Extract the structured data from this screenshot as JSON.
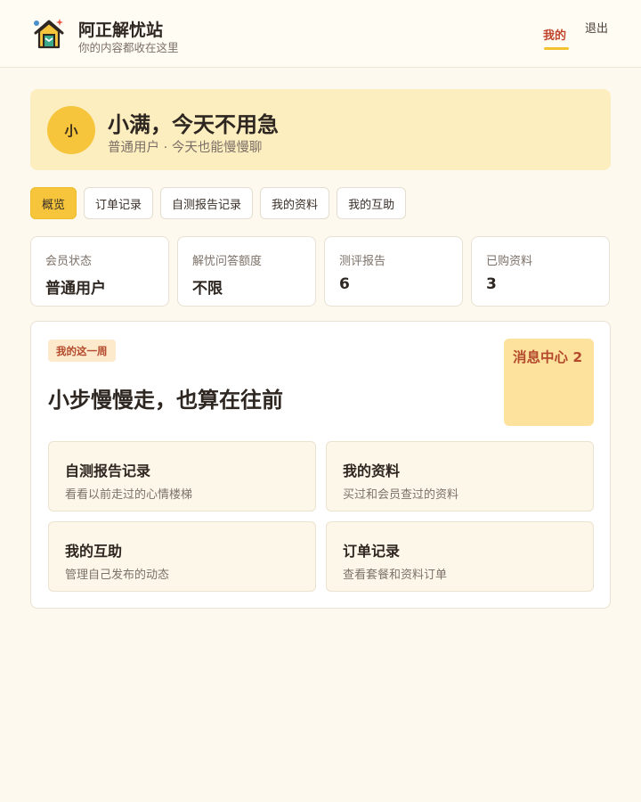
{
  "header": {
    "logo_icon": "house-icon",
    "title": "阿正解忧站",
    "subtitle": "你的内容都收在这里",
    "nav_mine": "我的",
    "nav_logout": "退出"
  },
  "profile": {
    "avatar": "小",
    "greeting": "小满，今天不用急",
    "subtitle": "普通用户 · 今天也能慢慢聊"
  },
  "tabs": [
    {
      "label": "概览",
      "active": true
    },
    {
      "label": "订单记录"
    },
    {
      "label": "自测报告记录"
    },
    {
      "label": "我的资料"
    },
    {
      "label": "我的互助"
    }
  ],
  "stats": [
    {
      "label": "会员状态",
      "value": "普通用户"
    },
    {
      "label": "解忧问答额度",
      "value": "不限"
    },
    {
      "label": "测评报告",
      "value": "6"
    },
    {
      "label": "已购资料",
      "value": "3"
    }
  ],
  "week": {
    "badge": "我的这一周",
    "title": "小步慢慢走，也算在往前",
    "message_center": "消息中心 2"
  },
  "cards": [
    {
      "title": "自测报告记录",
      "desc": "看看以前走过的心情楼梯"
    },
    {
      "title": "我的资料",
      "desc": "买过和会员查过的资料"
    },
    {
      "title": "我的互助",
      "desc": "管理自己发布的动态"
    },
    {
      "title": "订单记录",
      "desc": "查看套餐和资料订单"
    }
  ],
  "colors": {
    "accent": "#f6c53c",
    "brand_red": "#c0452c",
    "background": "#fdf9ee"
  }
}
